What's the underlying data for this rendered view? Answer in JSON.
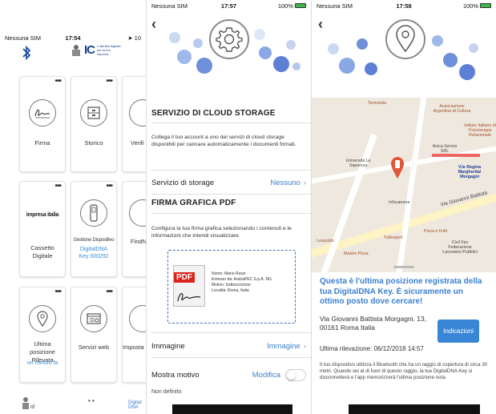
{
  "screen1": {
    "status": {
      "carrier": "Nessuna SIM",
      "time": "17:54",
      "battery_text": "10"
    },
    "logo": {
      "brand": "IC",
      "tagline": "L'identità digitale per la tua impresa"
    },
    "tiles": [
      {
        "label": "Firma",
        "sub": "",
        "icon": "signature-icon"
      },
      {
        "label": "Storico",
        "sub": "",
        "icon": "archive-icon"
      },
      {
        "label": "Verifi",
        "sub": "",
        "icon": "verify-icon"
      },
      {
        "label": "Cassetto Digitale",
        "top": "impresa italia",
        "sub": "",
        "icon": "impresa-italia-logo"
      },
      {
        "label": "Gestione Dispositivo",
        "sub": "DigitalDNA Key 000292",
        "icon": "usb-key-icon"
      },
      {
        "label": "FindN",
        "sub": "",
        "icon": "fingerprint-icon"
      },
      {
        "label": "Ultima posizione Rilevata",
        "sub": "un minuto fa",
        "icon": "location-pin-icon"
      },
      {
        "label": "Servizi web",
        "sub": "",
        "icon": "web-services-icon"
      },
      {
        "label": "Imposta",
        "sub": "",
        "icon": "settings-icon"
      }
    ],
    "bottom": {
      "page_dots": "• •",
      "right_label": "Digital DNA"
    }
  },
  "screen2": {
    "status": {
      "carrier": "Nessuna SIM",
      "time": "17:57",
      "battery": "100%"
    },
    "cloud_title": "SERVIZIO DI CLOUD STORAGE",
    "cloud_desc": "Collega il tuo account a uno dei servizi di cloud storage disponibili per caricare automaticamente i documenti firmati.",
    "storage_label": "Servizio di storage",
    "storage_value": "Nessuno",
    "pdf_title": "FIRMA GRAFICA PDF",
    "pdf_desc": "Configura la tua firma grafica selezionando i contenuti e le informazioni che intendi visualizzare.",
    "sig_info": [
      "Nome: Mario Rossi",
      "Emesso da: ArubaPEC S.p.A. NG",
      "Motivo: Sottoscrizione",
      "Località: Roma, Italia"
    ],
    "pdf_tag": "PDF",
    "image_label": "Immagine",
    "image_value": "Immagine",
    "motive_label": "Mostra motivo",
    "motive_value": "Modifica",
    "motive_sub": "Non definito"
  },
  "screen3": {
    "status": {
      "carrier": "Nessuna SIM",
      "time": "17:58",
      "battery": "100%"
    },
    "map_labels": [
      "Termovita",
      "Associazione Argentina di Cultura",
      "Istituto Italiano di Psicoterapia Relazionale",
      "Università La Sapienza",
      "Anica Servizi SRL",
      "V.le Regina Margherita/ Morgagni",
      "Infocamere",
      "Via Giovanni Battista",
      "Leopoldo",
      "Tuttosport",
      "Pizza e Fritti",
      "Civil Fps Federazione Lavoratori Pubblici",
      "Mastro Pizza"
    ],
    "card_title": "Questa è l'ultima posizione registrata della tua DigitalDNA Key. È sicuramente un ottimo posto dove cercare!",
    "address_line1": "Via Giovanni Battista Morgagni, 13,",
    "address_line2": "00161 Roma Italia",
    "button": "Indicazioni",
    "last_detected": "Ultima rilevazione: 06/12/2018 14:57",
    "note": "Il tuo dispositivo utilizza il Bluetooth che ha un raggio di copertura di circa 30 metri. Quando sei al di fuori di questo raggio, la tua DigitalDNA Key si disconnetterà e l'app memorizzerà l'ultima posizione nota."
  },
  "colors": {
    "accent": "#3a7fd0",
    "button": "#3a86d6",
    "pin": "#e2553b",
    "pdf": "#d9251d"
  }
}
